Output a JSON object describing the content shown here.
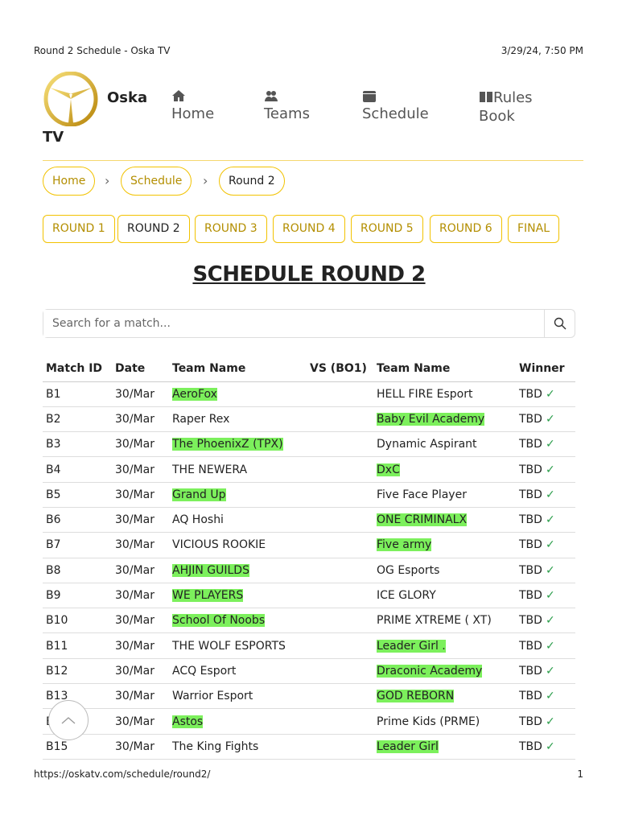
{
  "print_header": {
    "title": "Round 2 Schedule - Oska TV",
    "datetime": "3/29/24, 7:50 PM"
  },
  "print_footer": {
    "url": "https://oskatv.com/schedule/round2/",
    "page": "1"
  },
  "brand": {
    "line1": "Oska",
    "line2": "TV"
  },
  "nav": [
    {
      "label": "Home",
      "icon": "home-icon"
    },
    {
      "label": "Teams",
      "icon": "users-icon"
    },
    {
      "label": "Schedule",
      "icon": "calendar-icon"
    },
    {
      "label1": "Rules",
      "label2": "Book",
      "icon": "book-icon"
    }
  ],
  "breadcrumb": [
    "Home",
    "Schedule",
    "Round 2"
  ],
  "rounds": [
    "ROUND 1",
    "ROUND 2",
    "ROUND 3",
    "ROUND 4",
    "ROUND 5",
    "ROUND 6",
    "FINAL"
  ],
  "title": "SCHEDULE ROUND 2",
  "search": {
    "placeholder": "Search for a match..."
  },
  "colors": {
    "accent": "#f2c200",
    "highlight": "#7cf05c"
  },
  "table": {
    "headers": [
      "Match ID",
      "Date",
      "Team Name",
      "VS (BO1)",
      "Team Name",
      "Winner"
    ],
    "rows": [
      [
        "B1",
        "30/Mar",
        "AeroFox",
        "HELL FIRE Esport",
        "TBD",
        1
      ],
      [
        "B2",
        "30/Mar",
        "Raper Rex",
        "Baby Evil Academy",
        "TBD",
        2
      ],
      [
        "B3",
        "30/Mar",
        "The PhoenixZ (TPX)",
        "Dynamic Aspirant",
        "TBD",
        1
      ],
      [
        "B4",
        "30/Mar",
        "THE NEWERA",
        "DxC",
        "TBD",
        2
      ],
      [
        "B5",
        "30/Mar",
        "Grand Up",
        "Five Face Player",
        "TBD",
        1
      ],
      [
        "B6",
        "30/Mar",
        "AQ Hoshi",
        "ONE CRIMINALX",
        "TBD",
        2
      ],
      [
        "B7",
        "30/Mar",
        "VICIOUS ROOKIE",
        "Five army",
        "TBD",
        2
      ],
      [
        "B8",
        "30/Mar",
        "AHJIN GUILDS",
        "OG Esports",
        "TBD",
        1
      ],
      [
        "B9",
        "30/Mar",
        "WE PLAYERS",
        "ICE GLORY",
        "TBD",
        1
      ],
      [
        "B10",
        "30/Mar",
        "School Of Noobs",
        "PRIME XTREME ( XT)",
        "TBD",
        1
      ],
      [
        "B11",
        "30/Mar",
        "THE WOLF ESPORTS",
        "Leader Girl .",
        "TBD",
        2
      ],
      [
        "B12",
        "30/Mar",
        "ACQ Esport",
        "Draconic Academy",
        "TBD",
        2
      ],
      [
        "B13",
        "30/Mar",
        "Warrior Esport",
        "GOD REBORN",
        "TBD",
        2
      ],
      [
        "B14",
        "30/Mar",
        "Astos",
        "Prime Kids (PRME)",
        "TBD",
        1
      ],
      [
        "B15",
        "30/Mar",
        "The King Fights",
        "Leader Girl",
        "TBD",
        2
      ]
    ]
  }
}
